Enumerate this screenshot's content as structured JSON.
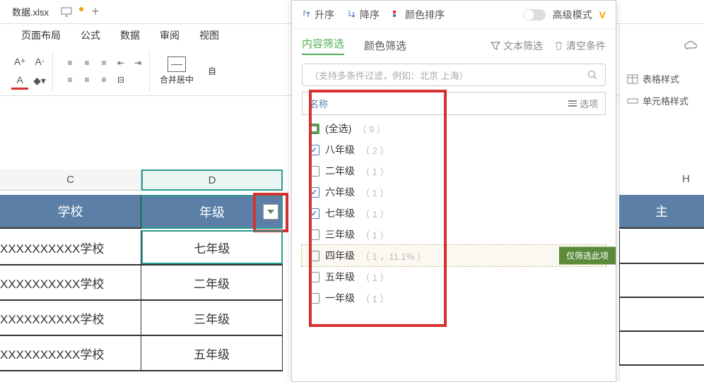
{
  "file_tab": "数据.xlsx",
  "ribbon": [
    "页面布局",
    "公式",
    "数据",
    "审阅",
    "视图"
  ],
  "toolbar": {
    "merge_center": "合并居中",
    "auto": "自"
  },
  "sort_panel": {
    "asc": "升序",
    "desc": "降序",
    "color_sort": "颜色排序",
    "advanced": "高级模式"
  },
  "filter_tabs": {
    "content": "内容筛选",
    "color": "颜色筛选",
    "text": "文本筛选",
    "clear": "清空条件"
  },
  "search_placeholder": "（支持多条件过滤，例如：北京  上海）",
  "name_header": "名称",
  "options": "选项",
  "only_this": "仅筛选此项",
  "filter_items": [
    {
      "label": "(全选)",
      "count": "（ 9 ）",
      "type": "all"
    },
    {
      "label": "八年级",
      "count": "（ 2 ）",
      "type": "checked"
    },
    {
      "label": "二年级",
      "count": "（ 1 ）",
      "type": "unchecked"
    },
    {
      "label": "六年级",
      "count": "（ 1 ）",
      "type": "checked"
    },
    {
      "label": "七年级",
      "count": "（ 1 ）",
      "type": "checked"
    },
    {
      "label": "三年级",
      "count": "（ 1 ）",
      "type": "unchecked"
    },
    {
      "label": "四年级",
      "count": "（ 1 ，11.1% ）",
      "type": "unchecked",
      "highlighted": true
    },
    {
      "label": "五年级",
      "count": "（ 1 ）",
      "type": "unchecked"
    },
    {
      "label": "一年级",
      "count": "（ 1 ）",
      "type": "unchecked"
    }
  ],
  "right_panel": {
    "table_style": "表格样式",
    "cell_style": "单元格样式"
  },
  "columns": {
    "c": "C",
    "d": "D",
    "h": "H"
  },
  "table_headers": {
    "school": "学校",
    "grade": "年级",
    "note": "主"
  },
  "table_data": [
    {
      "school": "XXXXXXXXXX学校",
      "grade": "七年级"
    },
    {
      "school": "XXXXXXXXXX学校",
      "grade": "二年级"
    },
    {
      "school": "XXXXXXXXXX学校",
      "grade": "三年级"
    },
    {
      "school": "XXXXXXXXXX学校",
      "grade": "五年级"
    }
  ]
}
